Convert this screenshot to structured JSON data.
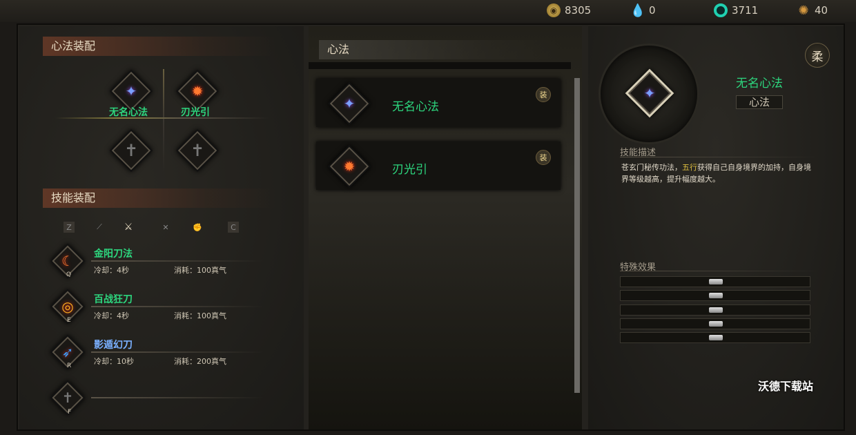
{
  "resources": [
    {
      "icon": "coin-icon",
      "value": "8305"
    },
    {
      "icon": "water-drop-icon",
      "value": "0"
    },
    {
      "icon": "jade-ring-icon",
      "value": "3711"
    },
    {
      "icon": "gear-medal-icon",
      "value": "40"
    }
  ],
  "left": {
    "mind_title": "心法装配",
    "slots": [
      {
        "label": "无名心法",
        "icon": "blue-flame-icon",
        "color": "#2dd67e"
      },
      {
        "label": "刃光引",
        "icon": "red-flame-icon",
        "color": "#2dd67e"
      }
    ],
    "skill_title": "技能装配",
    "tabs": [
      "Z",
      "C"
    ],
    "skills": [
      {
        "name": "金阳刀法",
        "key": "Q",
        "cooldown": "冷却：4秒",
        "cost": "消耗：100真气",
        "color": "#2dd67e"
      },
      {
        "name": "百战狂刀",
        "key": "E",
        "cooldown": "冷却：4秒",
        "cost": "消耗：100真气",
        "color": "#2dd67e"
      },
      {
        "name": "影遁幻刀",
        "key": "R",
        "cooldown": "冷却：10秒",
        "cost": "消耗：200真气",
        "color": "#7ab0ff"
      },
      {
        "name": "",
        "key": "F",
        "cooldown": "",
        "cost": ""
      }
    ]
  },
  "middle": {
    "title": "心法",
    "items": [
      {
        "name": "无名心法",
        "equip": "装"
      },
      {
        "name": "刃光引",
        "equip": "装"
      }
    ]
  },
  "right": {
    "badge": "柔",
    "name": "无名心法",
    "type": "心法",
    "desc_title": "技能描述",
    "desc_pre": "苍玄门秘传功法，",
    "desc_highlight": "五行",
    "desc_post": "获得自己自身境界的加持，自身境界等级越高，提升幅度越大。",
    "effects_title": "特殊效果",
    "effects_count": 5
  },
  "watermark": "沃德下载站",
  "colors": {
    "green": "#2dd67e",
    "gold": "#e0c040"
  }
}
